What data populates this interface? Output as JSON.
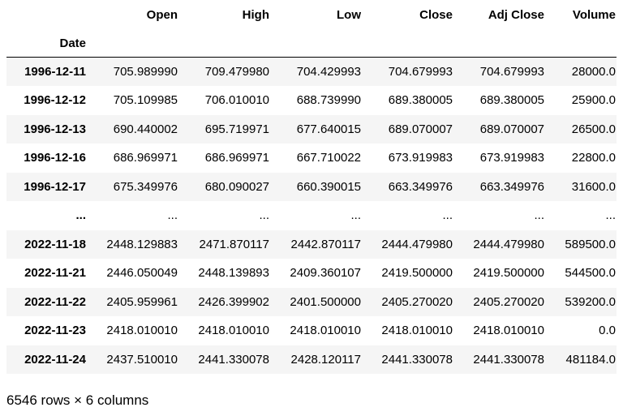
{
  "table": {
    "index_name": "Date",
    "columns": [
      "Open",
      "High",
      "Low",
      "Close",
      "Adj Close",
      "Volume"
    ],
    "rows": [
      {
        "index": "1996-12-11",
        "cells": [
          "705.989990",
          "709.479980",
          "704.429993",
          "704.679993",
          "704.679993",
          "28000.0"
        ]
      },
      {
        "index": "1996-12-12",
        "cells": [
          "705.109985",
          "706.010010",
          "688.739990",
          "689.380005",
          "689.380005",
          "25900.0"
        ]
      },
      {
        "index": "1996-12-13",
        "cells": [
          "690.440002",
          "695.719971",
          "677.640015",
          "689.070007",
          "689.070007",
          "26500.0"
        ]
      },
      {
        "index": "1996-12-16",
        "cells": [
          "686.969971",
          "686.969971",
          "667.710022",
          "673.919983",
          "673.919983",
          "22800.0"
        ]
      },
      {
        "index": "1996-12-17",
        "cells": [
          "675.349976",
          "680.090027",
          "660.390015",
          "663.349976",
          "663.349976",
          "31600.0"
        ]
      },
      {
        "index": "...",
        "cells": [
          "...",
          "...",
          "...",
          "...",
          "...",
          "..."
        ]
      },
      {
        "index": "2022-11-18",
        "cells": [
          "2448.129883",
          "2471.870117",
          "2442.870117",
          "2444.479980",
          "2444.479980",
          "589500.0"
        ]
      },
      {
        "index": "2022-11-21",
        "cells": [
          "2446.050049",
          "2448.139893",
          "2409.360107",
          "2419.500000",
          "2419.500000",
          "544500.0"
        ]
      },
      {
        "index": "2022-11-22",
        "cells": [
          "2405.959961",
          "2426.399902",
          "2401.500000",
          "2405.270020",
          "2405.270020",
          "539200.0"
        ]
      },
      {
        "index": "2022-11-23",
        "cells": [
          "2418.010010",
          "2418.010010",
          "2418.010010",
          "2418.010010",
          "2418.010010",
          "0.0"
        ]
      },
      {
        "index": "2022-11-24",
        "cells": [
          "2437.510010",
          "2441.330078",
          "2428.120117",
          "2441.330078",
          "2441.330078",
          "481184.0"
        ]
      }
    ]
  },
  "shape_caption": "6546 rows × 6 columns",
  "colors": {
    "striped_row": "#f5f5f5",
    "header_rule": "#000000",
    "text": "#000000"
  }
}
